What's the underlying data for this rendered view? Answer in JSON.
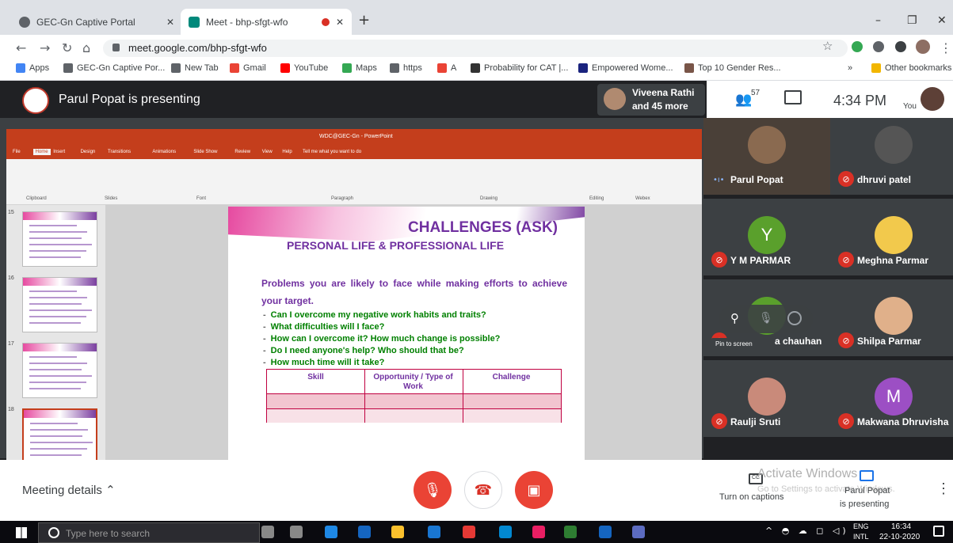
{
  "browser": {
    "tabs": [
      {
        "label": "GEC-Gn Captive Portal"
      },
      {
        "label": "Meet - bhp-sfgt-wfo"
      }
    ],
    "new_tab": "+",
    "window": {
      "minimize": "–",
      "restore": "❐",
      "close": "✕"
    },
    "url": "meet.google.com/bhp-sfgt-wfo",
    "bookmarks": [
      "Apps",
      "GEC-Gn Captive Por...",
      "New Tab",
      "Gmail",
      "YouTube",
      "Maps",
      "https",
      "A",
      "Probability for CAT |...",
      "Empowered Wome...",
      "Top 10 Gender Res..."
    ],
    "bookmarks_more": "»",
    "other_bookmarks": "Other bookmarks"
  },
  "meet": {
    "presenting_banner": "Parul Popat is presenting",
    "others": {
      "line1": "Viveena Rathi",
      "line2": "and 45 more"
    },
    "participant_count": "57",
    "time": "4:34 PM",
    "you_label": "You",
    "participants": [
      {
        "name": "Parul Popat",
        "initial": "",
        "avatar_color": "#8a6a50"
      },
      {
        "name": "dhruvi patel",
        "initial": "",
        "avatar_color": "#555"
      },
      {
        "name": "Y M PARMAR",
        "initial": "Y",
        "avatar_color": "#5aa02c"
      },
      {
        "name": "Meghna Parmar",
        "initial": "",
        "avatar_color": "#f2c94c"
      },
      {
        "name": "a chauhan",
        "initial": "",
        "avatar_color": "#5aa02c"
      },
      {
        "name": "Shilpa Parmar",
        "initial": "",
        "avatar_color": "#e0b08a"
      },
      {
        "name": "Raulji Sruti",
        "initial": "",
        "avatar_color": "#c98a7a"
      },
      {
        "name": "Makwana Dhruvisha",
        "initial": "M",
        "avatar_color": "#9c4fc4"
      }
    ],
    "hover_tooltip": "Pin to screen",
    "meeting_details": "Meeting details",
    "captions": "Turn on captions",
    "presenting_status": {
      "line1": "Parul Popat",
      "line2": "is presenting"
    },
    "activate": {
      "title": "Activate Windows",
      "sub": "Go to Settings to activate Windows."
    }
  },
  "ppt": {
    "title_bar": "WDC@GEC-Gn - PowerPoint",
    "ribbon_tabs": [
      "File",
      "Home",
      "Insert",
      "Design",
      "Transitions",
      "Animations",
      "Slide Show",
      "Review",
      "View",
      "Help",
      "Tell me what you want to do"
    ],
    "ribbon_groups": [
      "Clipboard",
      "Slides",
      "Font",
      "Paragraph",
      "Drawing",
      "Editing",
      "Webex"
    ],
    "slide_numbers": [
      "15",
      "16",
      "17",
      "18"
    ],
    "slide": {
      "title": "CHALLENGES (ASK)",
      "subtitle": "PERSONAL LIFE & PROFESSIONAL LIFE",
      "intro": "Problems you are likely to face while making efforts to achieve your target.",
      "bullets": [
        "Can I overcome my negative work habits and traits?",
        "What difficulties will I face?",
        "How can I overcome it? How much change is possible?",
        "Do I need anyone's help? Who should that be?",
        "How much time will it take?"
      ],
      "table_headers": [
        "Skill",
        "Opportunity / Type of Work",
        "Challenge"
      ]
    }
  },
  "taskbar": {
    "search_placeholder": "Type here to search",
    "lang": "ENG",
    "layout": "INTL",
    "clock_time": "16:34",
    "clock_date": "22-10-2020"
  },
  "colors": {
    "meet_dark": "#202124",
    "red": "#ea4335",
    "ppt_red": "#c43e1c",
    "slide_purple": "#7030a0",
    "slide_green": "#008000"
  }
}
